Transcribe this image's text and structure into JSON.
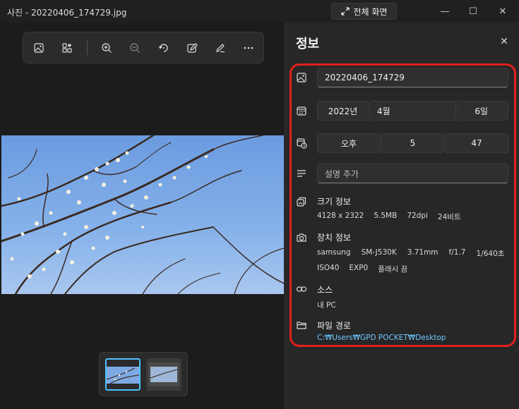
{
  "window": {
    "title": "사진 - 20220406_174729.jpg",
    "fullscreen_label": "전체 화면",
    "minimize": "—",
    "maximize": "☐",
    "close": "✕"
  },
  "toolbar": {
    "icons": [
      "image-icon",
      "collection-icon",
      "zoom-in-icon",
      "zoom-out-icon",
      "rotate-icon",
      "edit-image-icon",
      "draw-icon",
      "more-icon"
    ]
  },
  "info_panel": {
    "title": "정보",
    "close": "✕",
    "filename": "20220406_174729",
    "date": {
      "year": "2022년",
      "month": "4월",
      "day": "6일"
    },
    "time": {
      "ampm": "오후",
      "hour": "5",
      "minute": "47"
    },
    "description_placeholder": "설명 추가",
    "size_info": {
      "label": "크기 정보",
      "resolution": "4128 x 2322",
      "file_size": "5.5MB",
      "dpi": "72dpi",
      "bit_depth": "24비트"
    },
    "device_info": {
      "label": "장치 정보",
      "maker": "samsung",
      "model": "SM-J530K",
      "focal_length": "3.71mm",
      "aperture": "f/1.7",
      "shutter": "1/640초",
      "iso": "ISO40",
      "exposure": "EXP0",
      "flash": "플래시 끔"
    },
    "source": {
      "label": "소스",
      "value": "내 PC"
    },
    "file_path": {
      "label": "파일 경로",
      "value": "C:₩Users₩GPD POCKET₩Desktop"
    }
  },
  "colors": {
    "highlight": "#e0201d",
    "link": "#6cc6ff",
    "selected_thumb": "#4cc2ff"
  }
}
